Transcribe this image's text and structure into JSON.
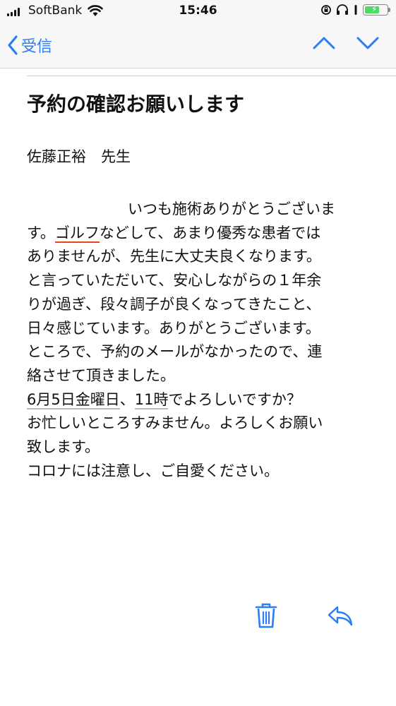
{
  "status_bar": {
    "carrier": "SoftBank",
    "time": "15:46",
    "battery_level": 0.7
  },
  "nav": {
    "back_label": "受信"
  },
  "mail": {
    "subject": "予約の確認お願いします",
    "recipient": "佐藤正裕　先生",
    "body": [
      {
        "segments": [
          {
            "text": "いつも施術ありがとうございま"
          }
        ]
      },
      {
        "segments": [
          {
            "text": "す。"
          },
          {
            "text": "ゴルフ",
            "underline": "red"
          },
          {
            "text": "などして、あまり優秀な患者では"
          }
        ]
      },
      {
        "segments": [
          {
            "text": "ありませんが、先生に大丈夫良くなります。"
          }
        ]
      },
      {
        "segments": [
          {
            "text": "と言っていただいて、安心しながらの１年余"
          }
        ]
      },
      {
        "segments": [
          {
            "text": "りが過ぎ、段々調子が良くなってきたこと、"
          }
        ]
      },
      {
        "segments": [
          {
            "text": "日々感じています。ありがとうございます。"
          }
        ]
      },
      {
        "segments": [
          {
            "text": "ところで、予約のメールがなかったので、連"
          }
        ]
      },
      {
        "segments": [
          {
            "text": "絡させて頂きました。"
          }
        ]
      },
      {
        "segments": [
          {
            "text": "6月5日金曜日",
            "underline": "gray"
          },
          {
            "text": "、"
          },
          {
            "text": "11時",
            "underline": "gray"
          },
          {
            "text": "でよろしいですか？"
          }
        ]
      },
      {
        "segments": [
          {
            "text": "お忙しいところすみません。よろしくお願い"
          }
        ]
      },
      {
        "segments": [
          {
            "text": "致します。"
          }
        ]
      },
      {
        "segments": [
          {
            "text": "コロナには注意し、ご自愛ください。"
          }
        ]
      }
    ]
  },
  "icons": {
    "back": "chevron-left-icon",
    "prev": "chevron-up-icon",
    "next": "chevron-down-icon",
    "trash": "trash-icon",
    "reply": "reply-icon"
  },
  "colors": {
    "accent": "#2b7cf6",
    "underline_red": "#e8441f",
    "underline_gray": "#b9b9b9",
    "battery": "#4cd964"
  }
}
